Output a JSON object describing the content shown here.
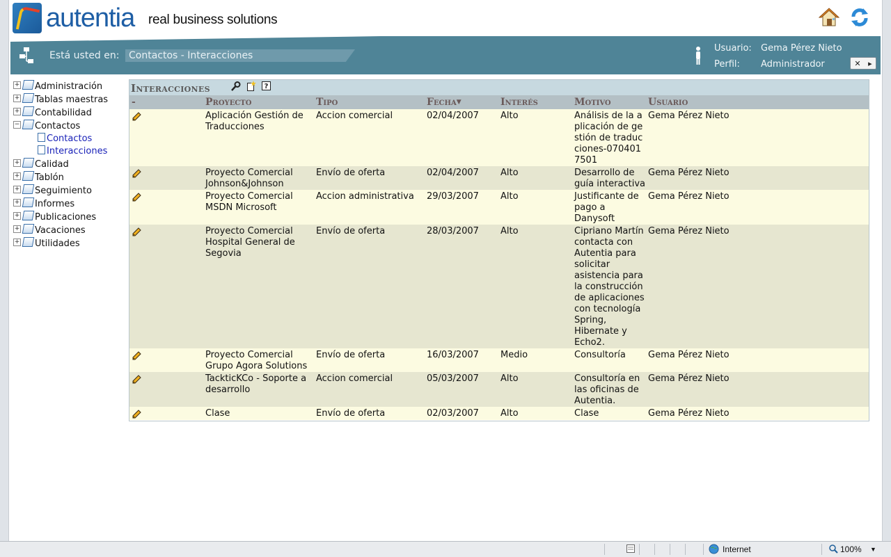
{
  "header": {
    "logo_text": "autentia",
    "tagline": "real business solutions"
  },
  "nav": {
    "breadcrumb_label": "Está usted en:",
    "breadcrumb": "Contactos - Interacciones",
    "user_label": "Usuario:",
    "user_value": "Gema Pérez Nieto",
    "profile_label": "Perfil:",
    "profile_value": "Administrador"
  },
  "sidebar": {
    "items": [
      {
        "label": "Administración",
        "expander": "+"
      },
      {
        "label": "Tablas maestras",
        "expander": "+"
      },
      {
        "label": "Contabilidad",
        "expander": "+"
      },
      {
        "label": "Contactos",
        "expander": "−"
      },
      {
        "label": "Calidad",
        "expander": "+"
      },
      {
        "label": "Tablón",
        "expander": "+"
      },
      {
        "label": "Seguimiento",
        "expander": "+"
      },
      {
        "label": "Informes",
        "expander": "+"
      },
      {
        "label": "Publicaciones",
        "expander": "+"
      },
      {
        "label": "Vacaciones",
        "expander": "+"
      },
      {
        "label": "Utilidades",
        "expander": "+"
      }
    ],
    "subitems": [
      {
        "label": "Contactos"
      },
      {
        "label": "Interacciones"
      }
    ]
  },
  "table": {
    "title": "Interacciones",
    "headers": {
      "edit": "-",
      "proyecto": "Proyecto",
      "tipo": "Tipo",
      "fecha": "Fecha",
      "interes": "Interés",
      "motivo": "Motivo",
      "usuario": "Usuario"
    },
    "rows": [
      {
        "proyecto": "Aplicación Gestión de Traducciones",
        "tipo": "Accion comercial",
        "fecha": "02/04/2007",
        "interes": "Alto",
        "motivo": "Análisis de la aplicación de gestión de traducciones-0704017501",
        "usuario": "Gema Pérez Nieto"
      },
      {
        "proyecto": "Proyecto Comercial Johnson&Johnson",
        "tipo": "Envío de oferta",
        "fecha": "02/04/2007",
        "interes": "Alto",
        "motivo": "Desarrollo de guía interactiva",
        "usuario": "Gema Pérez Nieto"
      },
      {
        "proyecto": "Proyecto Comercial MSDN Microsoft",
        "tipo": "Accion administrativa",
        "fecha": "29/03/2007",
        "interes": "Alto",
        "motivo": "Justificante de pago a Danysoft",
        "usuario": "Gema Pérez Nieto"
      },
      {
        "proyecto": "Proyecto Comercial Hospital General de Segovia",
        "tipo": "Envío de oferta",
        "fecha": "28/03/2007",
        "interes": "Alto",
        "motivo": "Cipriano Martín contacta con Autentia para solicitar asistencia para la construcción de aplicaciones con tecnología Spring, Hibernate y Echo2.",
        "usuario": "Gema Pérez Nieto"
      },
      {
        "proyecto": "Proyecto Comercial Grupo Agora Solutions",
        "tipo": "Envío de oferta",
        "fecha": "16/03/2007",
        "interes": "Medio",
        "motivo": "Consultoría",
        "usuario": "Gema Pérez Nieto"
      },
      {
        "proyecto": "TackticKCo - Soporte a desarrollo",
        "tipo": "Accion comercial",
        "fecha": "05/03/2007",
        "interes": "Alto",
        "motivo": "Consultoría en las oficinas de Autentia.",
        "usuario": "Gema Pérez Nieto"
      },
      {
        "proyecto": "Clase",
        "tipo": "Envío de oferta",
        "fecha": "02/03/2007",
        "interes": "Alto",
        "motivo": "Clase",
        "usuario": "Gema Pérez Nieto"
      }
    ]
  },
  "statusbar": {
    "zone": "Internet",
    "zoom": "100%"
  },
  "colors": {
    "nav_band": "#4f8497",
    "row_odd": "#fcfbe1",
    "row_even": "#e6e6d0",
    "header_row": "#b4c0c5",
    "title_bar": "#c7d9e0",
    "link": "#1a22b8"
  }
}
